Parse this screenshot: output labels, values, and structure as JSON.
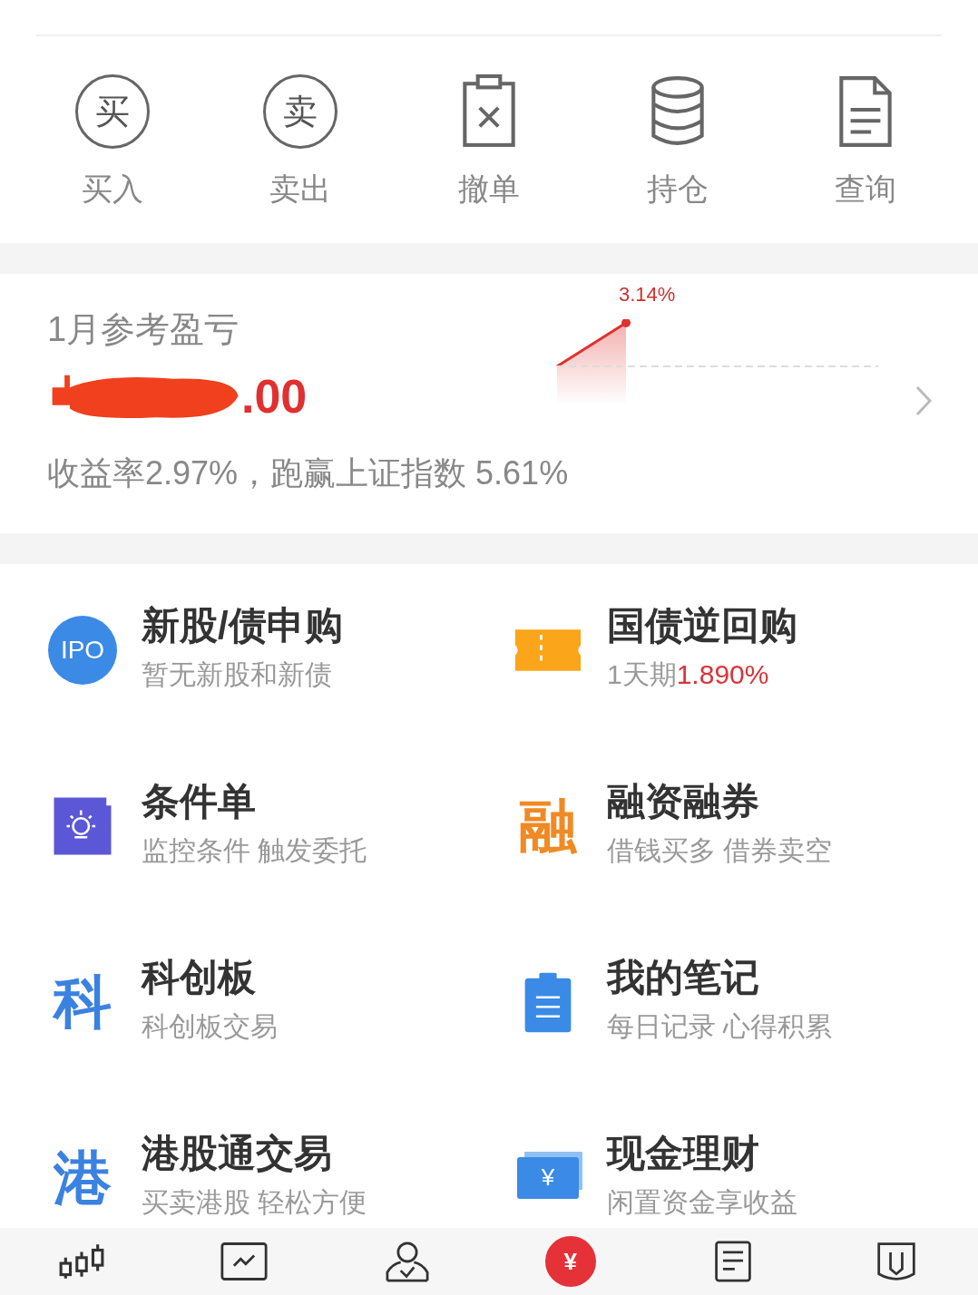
{
  "quick_actions": [
    {
      "kind": "char",
      "glyph": "买",
      "label": "买入"
    },
    {
      "kind": "char",
      "glyph": "卖",
      "label": "卖出"
    },
    {
      "kind": "cancel",
      "label": "撤单"
    },
    {
      "kind": "stack",
      "label": "持仓"
    },
    {
      "kind": "document",
      "label": "查询"
    }
  ],
  "profit_card": {
    "title": "1月参考盈亏",
    "amount_visible": ".00",
    "redacted": true,
    "summary": "收益率2.97%，跑赢上证指数 5.61%",
    "point_label": "3.14%"
  },
  "services": [
    {
      "kind": "ipo",
      "glyph": "IPO",
      "title": "新股/债申购",
      "subtitle": "暂无新股和新债"
    },
    {
      "kind": "ticket",
      "title": "国债逆回购",
      "subtitle": "1天期",
      "highlight": "1.890%"
    },
    {
      "kind": "bulb",
      "title": "条件单",
      "subtitle": "监控条件 触发委托"
    },
    {
      "kind": "char",
      "glyph": "融",
      "color": "#f08a24",
      "title": "融资融券",
      "subtitle": "借钱买多 借券卖空"
    },
    {
      "kind": "char",
      "glyph": "科",
      "color": "#3b82e0",
      "title": "科创板",
      "subtitle": "科创板交易"
    },
    {
      "kind": "note",
      "title": "我的笔记",
      "subtitle": "每日记录 心得积累"
    },
    {
      "kind": "char",
      "glyph": "港",
      "color": "#3b82e0",
      "title": "港股通交易",
      "subtitle": "买卖港股 轻松方便"
    },
    {
      "kind": "cash",
      "glyph": "¥",
      "title": "现金理财",
      "subtitle": "闲置资金享收益"
    }
  ],
  "bottom_nav": [
    {
      "kind": "candles",
      "selected": false
    },
    {
      "kind": "chart",
      "selected": false
    },
    {
      "kind": "person",
      "selected": false
    },
    {
      "kind": "yen",
      "glyph": "¥",
      "selected": true
    },
    {
      "kind": "document",
      "selected": false
    },
    {
      "kind": "shield",
      "selected": false
    }
  ]
}
